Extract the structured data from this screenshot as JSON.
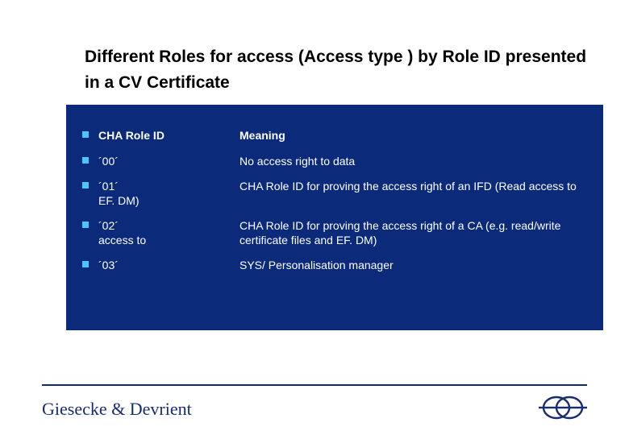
{
  "title": "Different Roles for access  (Access type ) by Role ID presented in a CV Certificate",
  "header": {
    "left": "CHA Role ID",
    "right": "Meaning"
  },
  "rows": [
    {
      "left": "´00´",
      "right": "No access right to data"
    },
    {
      "left": "´01´\nEF. DM)",
      "right": "CHA Role ID for proving the access right of an IFD (Read access to"
    },
    {
      "left": "´02´\naccess to",
      "right": "CHA Role ID for proving the access right of a CA (e.g. read/write                       certificate files and EF. DM)"
    },
    {
      "left": "´03´",
      "right": " SYS/ Personalisation manager"
    }
  ],
  "footer": {
    "brand": "Giesecke & Devrient"
  },
  "icons": {
    "bullet": "square-bullet-icon",
    "logo": "gd-logo-icon"
  }
}
